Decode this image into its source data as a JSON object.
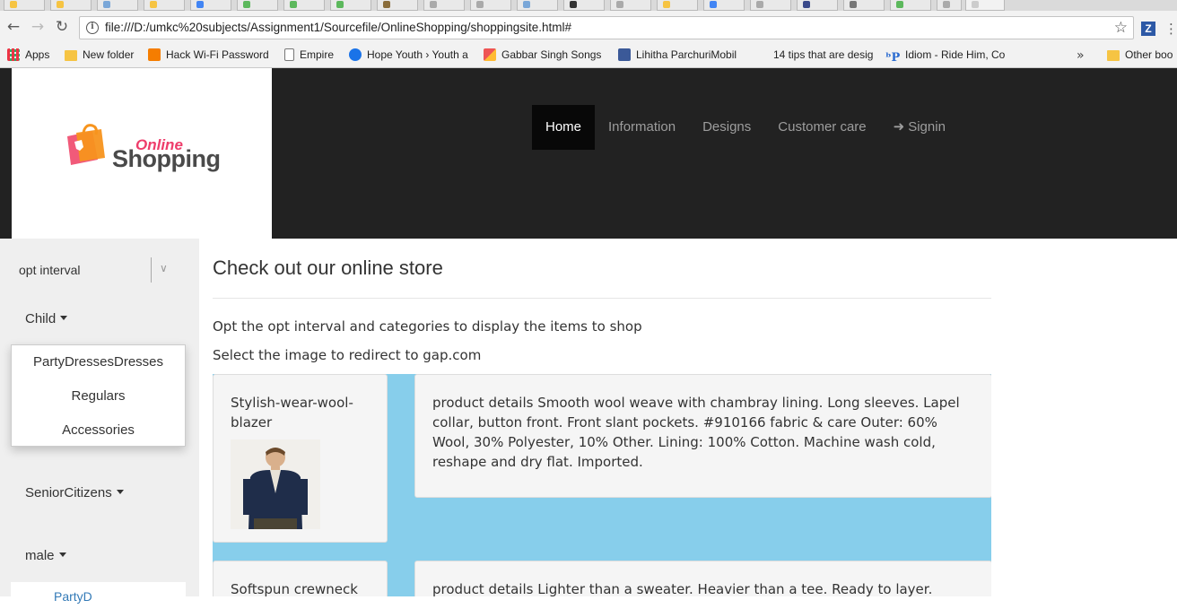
{
  "browser": {
    "url": "file:///D:/umkc%20subjects/Assignment1/Sourcefile/OnlineShopping/shoppingsite.html#",
    "bookmarks": [
      {
        "label": "Apps",
        "icon": "apps-grid-icon"
      },
      {
        "label": "New folder",
        "icon": "folder-icon"
      },
      {
        "label": "Hack Wi-Fi Password",
        "icon": "blogger-icon"
      },
      {
        "label": "Empire",
        "icon": "page-icon"
      },
      {
        "label": "Hope Youth › Youth a",
        "icon": "globe-icon"
      },
      {
        "label": "Gabbar Singh Songs",
        "icon": "site-icon"
      },
      {
        "label": "Lihitha ParchuriMobil",
        "icon": "facebook-icon"
      },
      {
        "label": "14 tips that are desig",
        "icon": "blank-icon"
      },
      {
        "label": "Idiom - Ride Him, Co",
        "icon": "idiom-icon"
      },
      {
        "label": "Other boo",
        "icon": "folder-icon"
      }
    ]
  },
  "header": {
    "logo_online": "Online",
    "logo_shopping": "Shopping",
    "nav": [
      {
        "label": "Home",
        "active": true
      },
      {
        "label": "Information",
        "active": false
      },
      {
        "label": "Designs",
        "active": false
      },
      {
        "label": "Customer care",
        "active": false
      },
      {
        "label": "Signin",
        "active": false
      }
    ]
  },
  "sidebar": {
    "select_label": "opt interval",
    "groups": [
      {
        "label": "Child",
        "items": [
          "PartyDressesDresses",
          "Regulars",
          "Accessories"
        ]
      },
      {
        "label": "SeniorCitizens"
      },
      {
        "label": "male",
        "items_partial": "PartyD"
      }
    ]
  },
  "main": {
    "heading": "Check out our online store",
    "intro1": "Opt the opt interval and categories to display the items to shop",
    "intro2": "Select the image to redirect to gap.com",
    "products": [
      {
        "title": "Stylish-wear-wool-blazer",
        "description": "product details Smooth wool weave with chambray lining. Long sleeves. Lapel collar, button front. Front slant pockets. #910166 fabric & care Outer: 60% Wool, 30% Polyester, 10% Other. Lining: 100% Cotton. Machine wash cold, reshape and dry flat. Imported."
      },
      {
        "title": "Softspun crewneck",
        "description": "product details Lighter than a sweater. Heavier than a tee. Ready to layer."
      }
    ]
  },
  "colors": {
    "navbar": "#222222",
    "active_nav": "#080808",
    "products_bg": "#87ceeb",
    "sidebar_bg": "#efefef"
  }
}
